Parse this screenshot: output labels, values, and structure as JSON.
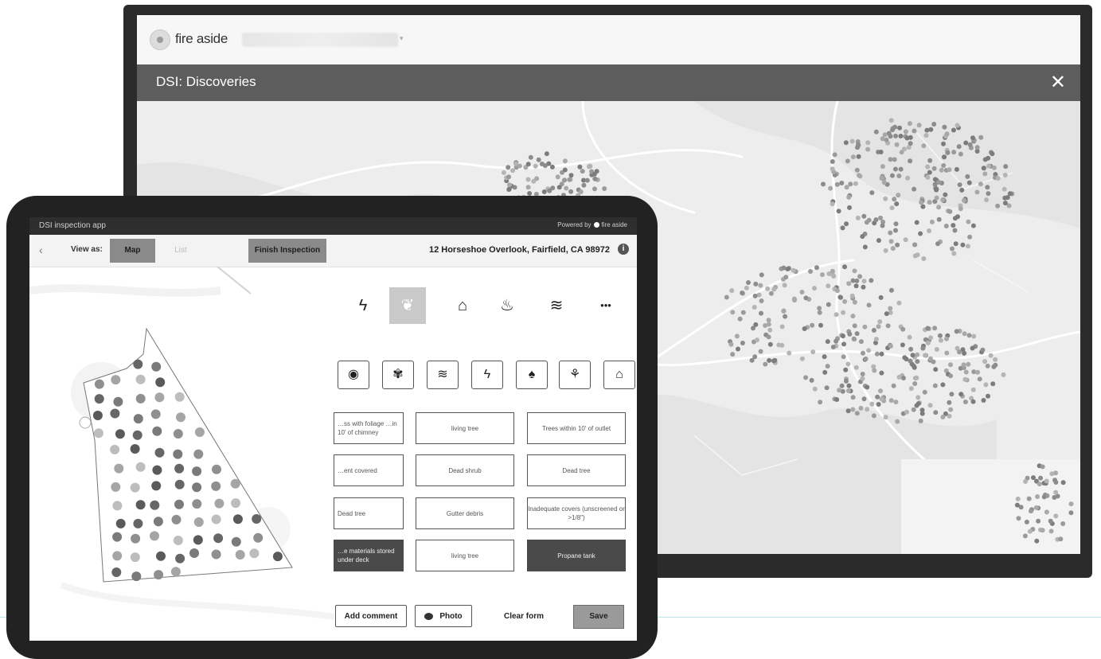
{
  "desktop": {
    "brand": "fire aside",
    "window_title": "DSI: Discoveries",
    "close_glyph": "✕"
  },
  "tablet": {
    "app_name": "DSI inspection app",
    "powered_by": "Powered by",
    "powered_brand": "fire aside",
    "back_glyph": "‹",
    "view_as": "View as:",
    "view_map": "Map",
    "view_list": "List",
    "finish_label": "Finish Inspection",
    "address": "12 Horseshoe Overlook, Fairfield, CA 98972",
    "info_glyph": "i",
    "category_icons": [
      {
        "name": "lightning-icon",
        "glyph": "ϟ"
      },
      {
        "name": "leaf-icon",
        "glyph": "❦"
      },
      {
        "name": "house-icon",
        "glyph": "⌂"
      },
      {
        "name": "flame-icon",
        "glyph": "♨"
      },
      {
        "name": "water-icon",
        "glyph": "≋"
      },
      {
        "name": "more-icon",
        "glyph": "•••"
      }
    ],
    "subcategory_icons": [
      {
        "name": "eye-icon",
        "glyph": "◉"
      },
      {
        "name": "plant-icon",
        "glyph": "✾"
      },
      {
        "name": "water-icon",
        "glyph": "≋"
      },
      {
        "name": "lightning-icon",
        "glyph": "ϟ"
      },
      {
        "name": "tree-icon",
        "glyph": "♠"
      },
      {
        "name": "palm-icon",
        "glyph": "⚘"
      },
      {
        "name": "house-icon",
        "glyph": "⌂"
      }
    ],
    "observations": [
      [
        "…ss with foliage …in 10' of chimney",
        "living tree",
        "Trees within 10' of outlet"
      ],
      [
        "…ent covered",
        "Dead shrub",
        "Dead tree"
      ],
      [
        "Dead tree",
        "Gutter debris",
        "Inadequate covers (unscreened or >1/8\")"
      ],
      [
        "…e materials stored under deck",
        "living tree",
        "Propane tank"
      ]
    ],
    "add_comment": "Add comment",
    "photo": "Photo",
    "clear_form": "Clear form",
    "save": "Save"
  }
}
